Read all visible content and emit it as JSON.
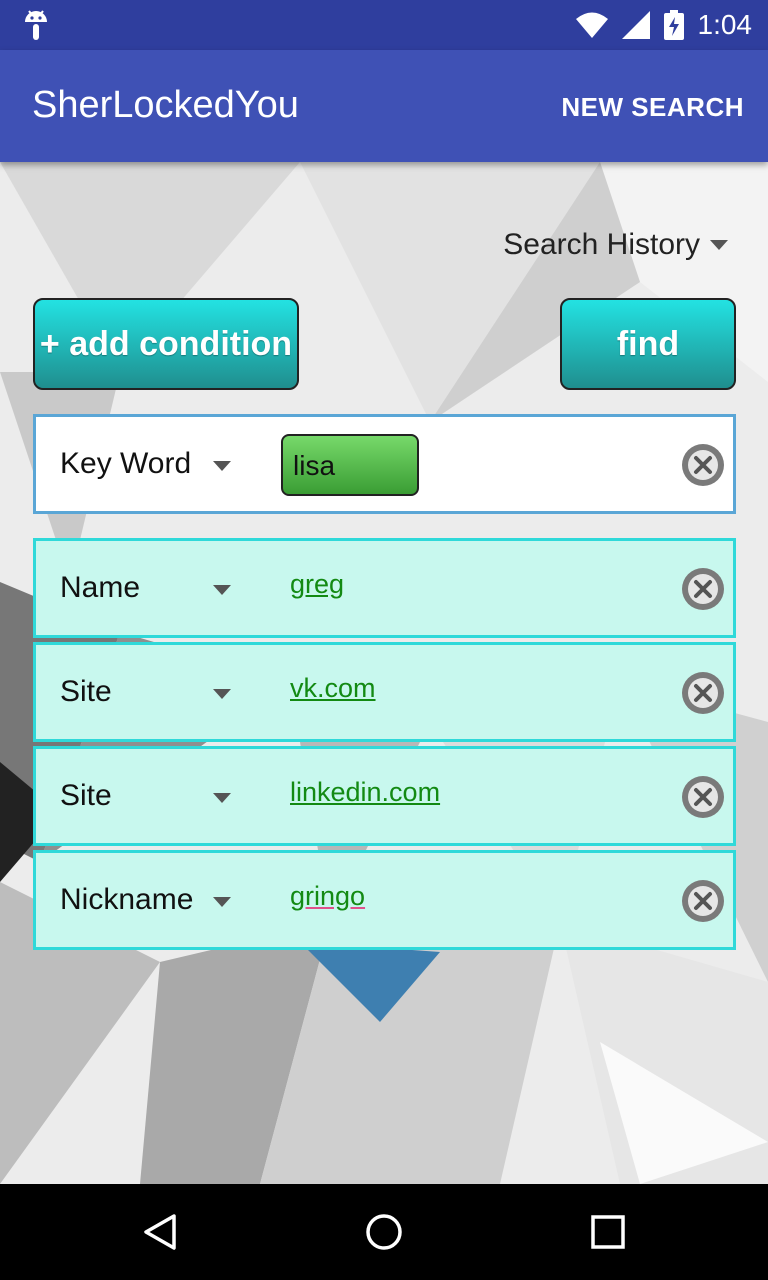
{
  "status_bar": {
    "time": "1:04",
    "icons": [
      "android-icon",
      "wifi-icon",
      "signal-icon",
      "battery-charging-icon"
    ]
  },
  "app_bar": {
    "title": "SherLockedYou",
    "action": "NEW SEARCH"
  },
  "search_history": {
    "label": "Search History",
    "icon": "dropdown-arrow-icon"
  },
  "buttons": {
    "add_condition": "+ add condition",
    "find": "find"
  },
  "conditions": [
    {
      "field": "Key Word",
      "value": "lisa"
    },
    {
      "field": "Name",
      "value": "greg"
    },
    {
      "field": "Site",
      "value": "vk.com"
    },
    {
      "field": "Site",
      "value": "linkedin.com"
    },
    {
      "field": "Nickname",
      "value": "gringo"
    }
  ],
  "nav_bar": {
    "icons": [
      "back-icon",
      "home-icon",
      "recents-icon"
    ]
  },
  "colors": {
    "status_bar": "#2f3e9e",
    "app_bar": "#3f51b5",
    "button_gradient_top": "#23e2e2",
    "button_gradient_bottom": "#1f8e8e",
    "row_background": "#c8f8ee",
    "row_border": "#2fd9d9",
    "value_text": "#138a13"
  }
}
